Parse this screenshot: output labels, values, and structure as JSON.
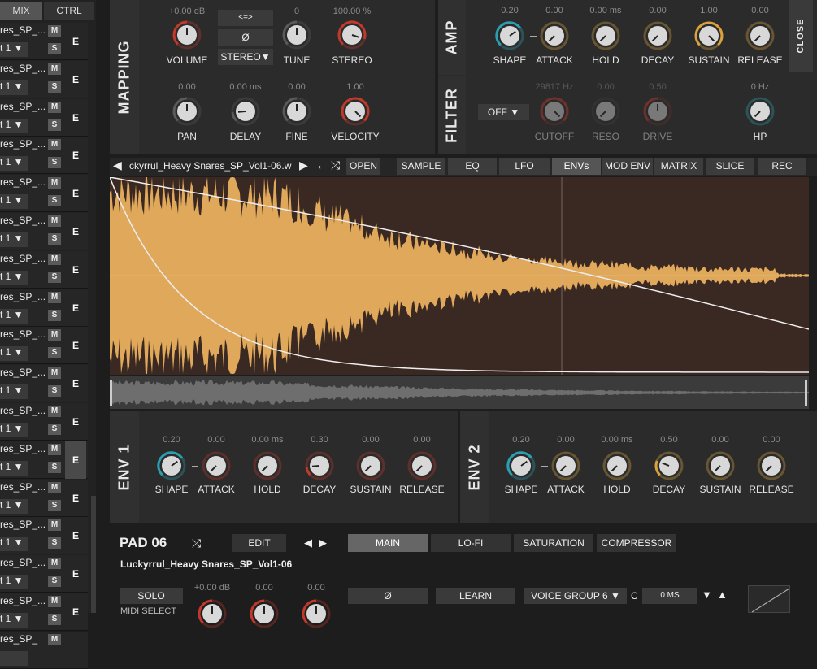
{
  "left": {
    "tabs": [
      "MIX",
      "CTRL"
    ],
    "rows": [
      {
        "name": "res_SP_...",
        "sub": "t 1 ▼",
        "m": "M",
        "s": "S",
        "e": "E"
      },
      {
        "name": "res_SP_...",
        "sub": "t 1 ▼",
        "m": "M",
        "s": "S",
        "e": "E"
      },
      {
        "name": "res_SP_...",
        "sub": "t 1 ▼",
        "m": "M",
        "s": "S",
        "e": "E"
      },
      {
        "name": "res_SP_...",
        "sub": "t 1 ▼",
        "m": "M",
        "s": "S",
        "e": "E"
      },
      {
        "name": "res_SP_...",
        "sub": "t 1 ▼",
        "m": "M",
        "s": "S",
        "e": "E"
      },
      {
        "name": "res_SP_...",
        "sub": "t 1 ▼",
        "m": "M",
        "s": "S",
        "e": "E"
      },
      {
        "name": "res_SP_...",
        "sub": "t 1 ▼",
        "m": "M",
        "s": "S",
        "e": "E"
      },
      {
        "name": "res_SP_...",
        "sub": "t 1 ▼",
        "m": "M",
        "s": "S",
        "e": "E"
      },
      {
        "name": "res_SP_...",
        "sub": "t 1 ▼",
        "m": "M",
        "s": "S",
        "e": "E"
      },
      {
        "name": "res_SP_...",
        "sub": "t 1 ▼",
        "m": "M",
        "s": "S",
        "e": "E"
      },
      {
        "name": "res_SP_...",
        "sub": "t 1 ▼",
        "m": "M",
        "s": "S",
        "e": "E"
      },
      {
        "name": "res_SP_...",
        "sub": "t 1 ▼",
        "m": "M",
        "s": "S",
        "e": "E"
      },
      {
        "name": "res_SP_...",
        "sub": "t 1 ▼",
        "m": "M",
        "s": "S",
        "e": "E"
      },
      {
        "name": "res_SP_...",
        "sub": "t 1 ▼",
        "m": "M",
        "s": "S",
        "e": "E"
      },
      {
        "name": "res_SP_...",
        "sub": "t 1 ▼",
        "m": "M",
        "s": "S",
        "e": "E"
      },
      {
        "name": "res_SP_...",
        "sub": "t 1 ▼",
        "m": "M",
        "s": "S",
        "e": "E"
      },
      {
        "name": "res_SP_",
        "sub": "",
        "m": "M",
        "s": "",
        "e": ""
      }
    ]
  },
  "mapping": {
    "title": "MAPPING",
    "volume": {
      "value": "+0.00 dB",
      "label": "VOLUME"
    },
    "tune": {
      "value": "0",
      "label": "TUNE"
    },
    "stereo": {
      "value": "100.00 %",
      "label": "STEREO"
    },
    "pan": {
      "value": "0.00",
      "label": "PAN"
    },
    "delay": {
      "value": "0.00 ms",
      "label": "DELAY"
    },
    "fine": {
      "value": "0.00",
      "label": "FINE"
    },
    "velocity": {
      "value": "1.00",
      "label": "VELOCITY"
    },
    "btn_link": "<=>",
    "btn_phase": "Ø",
    "btn_stereo": "STEREO▼"
  },
  "amp": {
    "title": "AMP",
    "close": "CLOSE",
    "shape": {
      "value": "0.20",
      "label": "SHAPE"
    },
    "attack": {
      "value": "0.00",
      "label": "ATTACK"
    },
    "hold": {
      "value": "0.00 ms",
      "label": "HOLD"
    },
    "decay": {
      "value": "0.00",
      "label": "DECAY"
    },
    "sustain": {
      "value": "1.00",
      "label": "SUSTAIN"
    },
    "release": {
      "value": "0.00",
      "label": "RELEASE"
    }
  },
  "filter": {
    "title": "FILTER",
    "mode": "OFF ▼",
    "cutoff": {
      "value": "29817 Hz",
      "label": "CUTOFF"
    },
    "reso": {
      "value": "0.00",
      "label": "RESO"
    },
    "drive": {
      "value": "0.50",
      "label": "DRIVE"
    },
    "hp": {
      "value": "0 Hz",
      "label": "HP"
    }
  },
  "sample": {
    "filename": "ckyrrul_Heavy Snares_SP_Vol1-06.w",
    "prev": "◀",
    "next": "▶",
    "undo": "←",
    "random": "⤮",
    "open": "OPEN",
    "tabs": [
      "SAMPLE",
      "EQ",
      "LFO",
      "ENVs",
      "MOD ENV",
      "MATRIX",
      "SLICE",
      "REC"
    ],
    "active_tab": "ENVs"
  },
  "env1": {
    "title": "ENV 1",
    "shape": {
      "value": "0.20",
      "label": "SHAPE"
    },
    "attack": {
      "value": "0.00",
      "label": "ATTACK"
    },
    "hold": {
      "value": "0.00 ms",
      "label": "HOLD"
    },
    "decay": {
      "value": "0.30",
      "label": "DECAY"
    },
    "sustain": {
      "value": "0.00",
      "label": "SUSTAIN"
    },
    "release": {
      "value": "0.00",
      "label": "RELEASE"
    }
  },
  "env2": {
    "title": "ENV 2",
    "shape": {
      "value": "0.20",
      "label": "SHAPE"
    },
    "attack": {
      "value": "0.00",
      "label": "ATTACK"
    },
    "hold": {
      "value": "0.00 ms",
      "label": "HOLD"
    },
    "decay": {
      "value": "0.50",
      "label": "DECAY"
    },
    "sustain": {
      "value": "0.00",
      "label": "SUSTAIN"
    },
    "release": {
      "value": "0.00",
      "label": "RELEASE"
    }
  },
  "pad": {
    "title": "PAD 06",
    "random": "⤮",
    "edit": "EDIT",
    "prev": "◀",
    "next": "▶",
    "tabs": [
      "MAIN",
      "LO-FI",
      "SATURATION",
      "COMPRESSOR"
    ],
    "active_tab": "MAIN",
    "sample_name": "Luckyrrul_Heavy Snares_SP_Vol1-06",
    "solo": "SOLO",
    "vol_value": "+0.00 dB",
    "v2": "0.00",
    "v3": "0.00",
    "phase": "Ø",
    "learn": "LEARN",
    "voice_group": "VOICE GROUP 6 ▼",
    "c": "C",
    "ms": "0 MS",
    "down": "▼",
    "up": "▲",
    "midi": "MIDI SELECT"
  },
  "colors": {
    "accent": "#d9a23c",
    "red_ring": "#c0392b",
    "blue_ring": "#2a9fb0",
    "wave": "#e0a85a"
  }
}
